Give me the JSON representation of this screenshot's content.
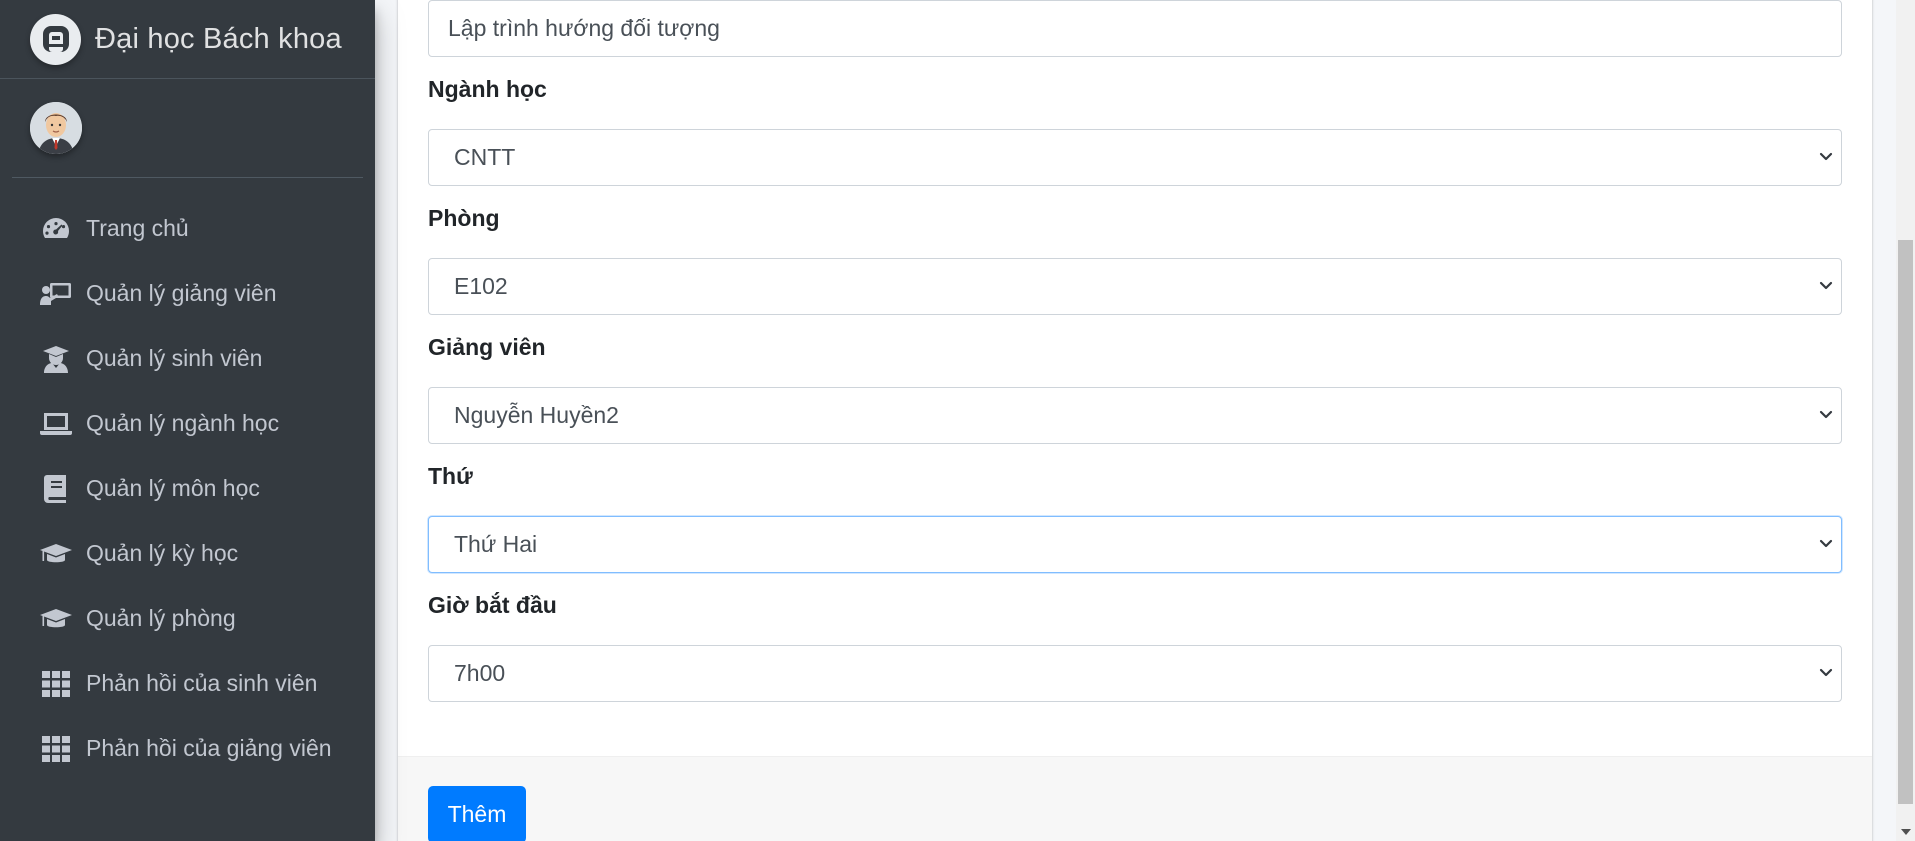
{
  "brand": {
    "name": "Đại học Bách khoa",
    "logo_icon": "brand-a-logo-icon"
  },
  "user": {
    "avatar_icon": "user-avatar"
  },
  "sidebar": {
    "items": [
      {
        "label": "Trang chủ",
        "icon": "dashboard-icon"
      },
      {
        "label": "Quản lý giảng viên",
        "icon": "teacher-icon"
      },
      {
        "label": "Quản lý sinh viên",
        "icon": "student-icon"
      },
      {
        "label": "Quản lý ngành học",
        "icon": "laptop-icon"
      },
      {
        "label": "Quản lý môn học",
        "icon": "book-icon"
      },
      {
        "label": "Quản lý kỳ học",
        "icon": "graduation-cap-icon"
      },
      {
        "label": "Quản lý phòng",
        "icon": "graduation-cap-icon"
      },
      {
        "label": "Phản hồi của sinh viên",
        "icon": "grid-icon"
      },
      {
        "label": "Phản hồi của giảng viên",
        "icon": "grid-icon"
      }
    ]
  },
  "form": {
    "subject_name_value": "Lập trình hướng đối tượng",
    "major": {
      "label": "Ngành học",
      "value": "CNTT"
    },
    "room": {
      "label": "Phòng",
      "value": "E102"
    },
    "lecturer": {
      "label": "Giảng viên",
      "value": "Nguyễn Huyền2"
    },
    "weekday": {
      "label": "Thứ",
      "value": "Thứ Hai"
    },
    "start_time": {
      "label": "Giờ bắt đầu",
      "value": "7h00"
    },
    "submit_label": "Thêm"
  },
  "colors": {
    "sidebar_bg": "#343a40",
    "sidebar_text": "#c2c7d0",
    "primary": "#007bff",
    "focus_border": "#80bdff"
  }
}
